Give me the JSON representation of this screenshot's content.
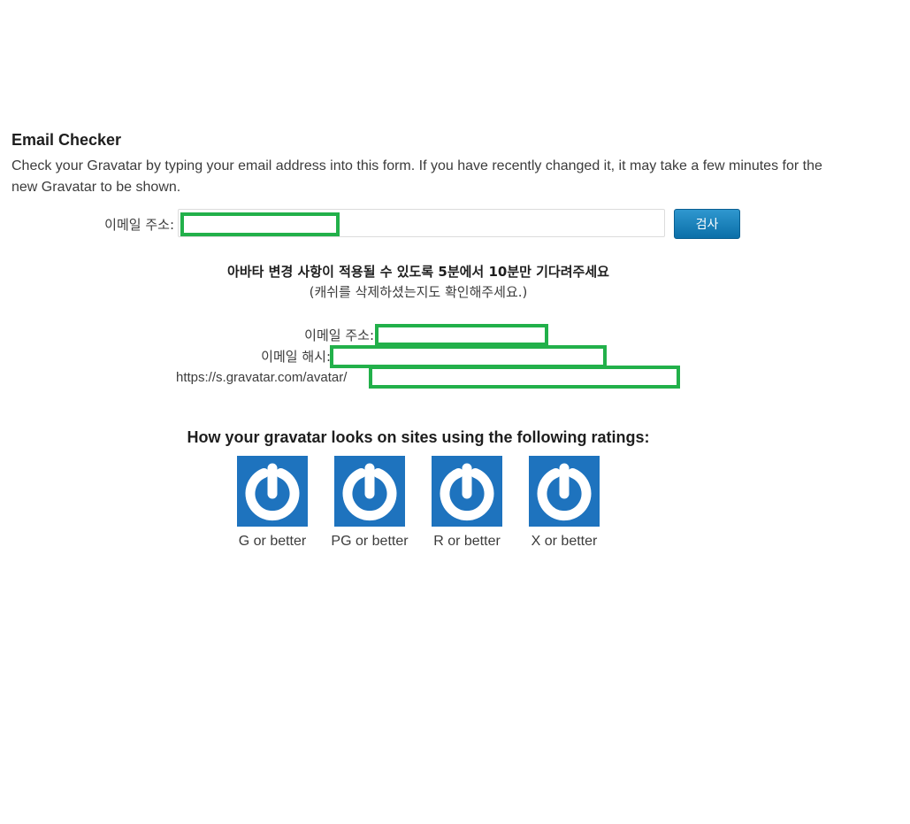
{
  "checker": {
    "title": "Email Checker",
    "intro": "Check your Gravatar by typing your email address into this form. If you have recently changed it, it may take a few minutes for the new Gravatar to be shown.",
    "email_label": "이메일 주소:",
    "email_value": "",
    "check_button": "검사"
  },
  "notice": {
    "main": "아바타 변경 사항이 적용될 수 있도록 5분에서 10분만 기다려주세요",
    "sub": "(캐쉬를 삭제하셨는지도 확인해주세요.)"
  },
  "result": {
    "email_label": "이메일 주소:",
    "hash_label": "이메일 해시:",
    "url_prefix": "https://s.gravatar.com/avatar/"
  },
  "ratings": {
    "heading": "How your gravatar looks on sites using the following ratings:",
    "items": [
      {
        "caption": "G or better",
        "icon": "gravatar-logo-icon"
      },
      {
        "caption": "PG or better",
        "icon": "gravatar-logo-icon"
      },
      {
        "caption": "R or better",
        "icon": "gravatar-logo-icon"
      },
      {
        "caption": "X or better",
        "icon": "gravatar-logo-icon"
      }
    ]
  },
  "colors": {
    "accent": "#1e73be",
    "button": "#0b6fa8",
    "redaction_border": "#22b04a"
  }
}
